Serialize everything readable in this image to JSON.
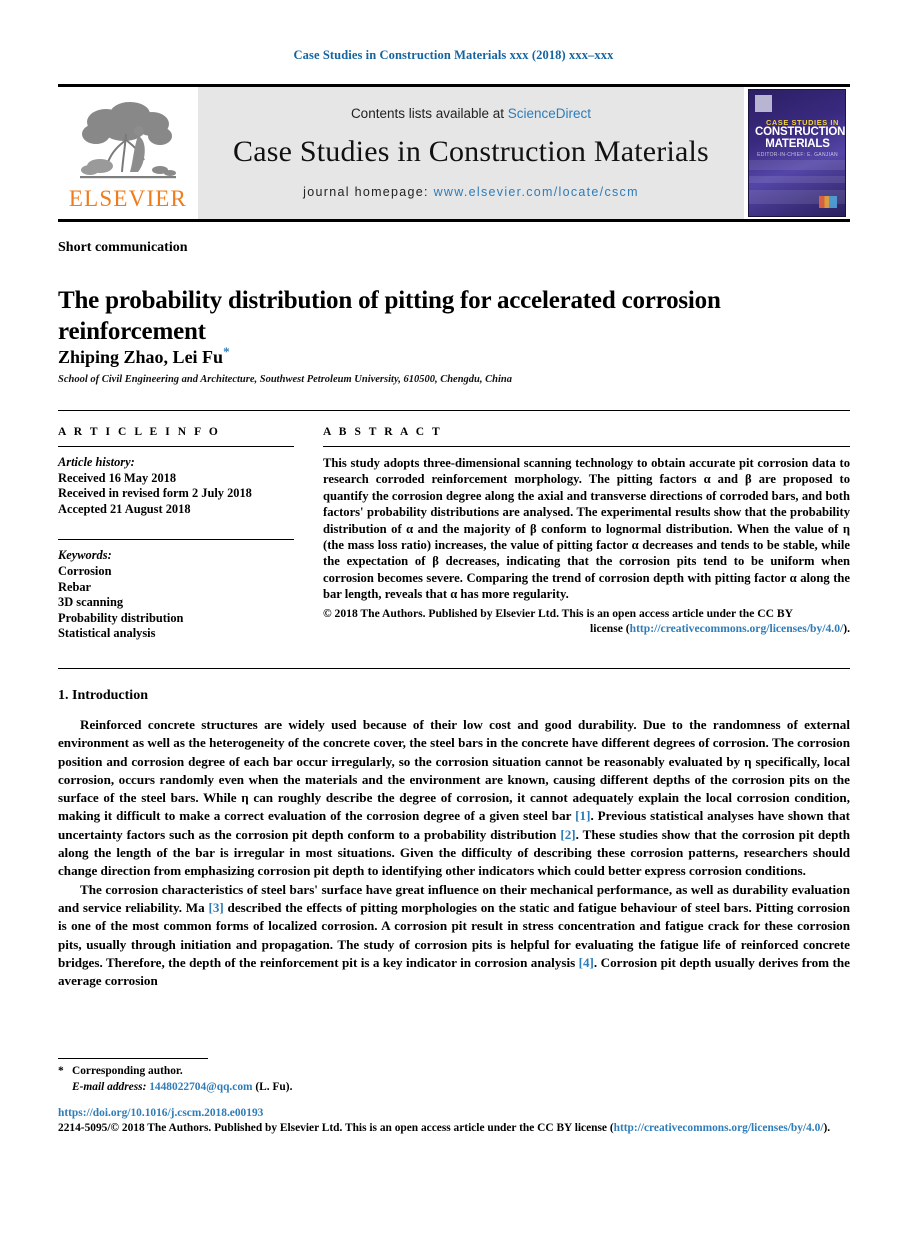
{
  "running_head": "Case Studies in Construction Materials xxx (2018) xxx–xxx",
  "header": {
    "contents_prefix": "Contents lists available at ",
    "sciencedirect": "ScienceDirect",
    "journal_title": "Case Studies in Construction Materials",
    "homepage_label": "journal homepage:",
    "homepage_url": "www.elsevier.com/locate/cscm",
    "publisher_logo_text": "ELSEVIER",
    "cover": {
      "line1": "CASE STUDIES IN",
      "line2": "CONSTRUCTION MATERIALS",
      "line3": "EDITOR-IN-CHIEF: E. GANJIAN"
    },
    "link_color": "#2e7cb8",
    "logo_color": "#ef7c1a"
  },
  "article": {
    "type": "Short communication",
    "title": "The probability distribution of pitting for accelerated corrosion reinforcement",
    "authors": "Zhiping Zhao, Lei Fu",
    "corresponding_marker": "*",
    "affiliation": "School of Civil Engineering and Architecture, Southwest Petroleum University, 610500, Chengdu, China"
  },
  "article_info": {
    "label": "A R T I C L E   I N F O",
    "history_heading": "Article history:",
    "history": [
      "Received 16 May 2018",
      "Received in revised form 2 July 2018",
      "Accepted 21 August 2018"
    ],
    "keywords_heading": "Keywords:",
    "keywords": [
      "Corrosion",
      "Rebar",
      "3D scanning",
      "Probability distribution",
      "Statistical analysis"
    ]
  },
  "abstract": {
    "label": "A B S T R A C T",
    "text": "This study adopts three-dimensional scanning technology to obtain accurate pit corrosion data to research corroded reinforcement morphology. The pitting factors α and β are proposed to quantify the corrosion degree along the axial and transverse directions of corroded bars, and both factors' probability distributions are analysed. The experimental results show that the probability distribution of α and the majority of β conform to lognormal distribution. When the value of η (the mass loss ratio) increases, the value of pitting factor α decreases and tends to be stable, while the expectation of β decreases, indicating that the corrosion pits tend to be uniform when corrosion becomes severe. Comparing the trend of corrosion depth with pitting factor α along the bar length, reveals that α has more regularity.",
    "copyright_line1": "© 2018 The Authors. Published by Elsevier Ltd. This is an open access article under the CC BY",
    "copyright_line2_prefix": "license (",
    "copyright_license_url": "http://creativecommons.org/licenses/by/4.0/",
    "copyright_line2_suffix": ")."
  },
  "body": {
    "section_heading": "1. Introduction",
    "paragraph1_a": "Reinforced concrete structures are widely used because of their low cost and good durability. Due to the randomness of external environment as well as the heterogeneity of the concrete cover, the steel bars in the concrete have different degrees of corrosion. The corrosion position and corrosion degree of each bar occur irregularly, so the corrosion situation cannot be reasonably evaluated by η specifically, local corrosion, occurs randomly even when the materials and the environment are known, causing different depths of the corrosion pits on the surface of the steel bars. While η can roughly describe the degree of corrosion, it cannot adequately explain the local corrosion condition, making it difficult to make a correct evaluation of the corrosion degree of a given steel bar ",
    "paragraph1_ref1": "[1]",
    "paragraph1_b": ". Previous statistical analyses have shown that uncertainty factors such as the corrosion pit depth conform to a probability distribution ",
    "paragraph1_ref2": "[2]",
    "paragraph1_c": ". These studies show that the corrosion pit depth along the length of the bar is irregular in most situations. Given the difficulty of describing these corrosion patterns, researchers should change direction from emphasizing corrosion pit depth to identifying other indicators which could better express corrosion conditions.",
    "paragraph2_a": "The corrosion characteristics of steel bars' surface have great influence on their mechanical performance, as well as durability evaluation and service reliability. Ma ",
    "paragraph2_ref3": "[3]",
    "paragraph2_b": " described the effects of pitting morphologies on the static and fatigue behaviour of steel bars. Pitting corrosion is one of the most common forms of localized corrosion. A corrosion pit result in stress concentration and fatigue crack for these corrosion pits, usually through initiation and propagation. The study of corrosion pits is helpful for evaluating the fatigue life of reinforced concrete bridges. Therefore, the depth of the reinforcement pit is a key indicator in corrosion analysis ",
    "paragraph2_ref4": "[4]",
    "paragraph2_c": ". Corrosion pit depth usually derives from the average corrosion"
  },
  "footnote": {
    "star": "*",
    "corresponding": "Corresponding author.",
    "email_label": "E-mail address:",
    "email": "1448022704@qq.com",
    "email_owner": "(L. Fu)."
  },
  "footer": {
    "doi": "https://doi.org/10.1016/j.cscm.2018.e00193",
    "issn_line_a": "2214-5095/© 2018 The Authors. Published by Elsevier Ltd. This is an open access article under the CC BY license (",
    "issn_license_url": "http://creativecommons.org/licenses/by/4.0/",
    "issn_line_b": ")."
  }
}
